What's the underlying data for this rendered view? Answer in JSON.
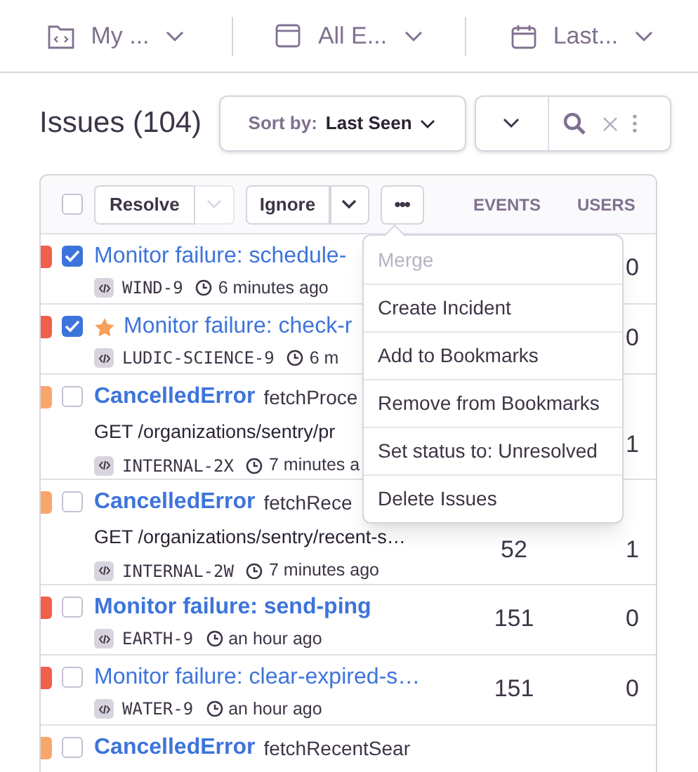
{
  "filters": [
    {
      "kind": "project",
      "label": "My ..."
    },
    {
      "kind": "environment",
      "label": "All E..."
    },
    {
      "kind": "date",
      "label": "Last..."
    }
  ],
  "header": {
    "title": "Issues (104)",
    "sort_label": "Sort by:",
    "sort_value": "Last Seen"
  },
  "toolbar": {
    "select_all_checked": false,
    "resolve": "Resolve",
    "resolve_menu_disabled": true,
    "ignore": "Ignore",
    "more": "•••",
    "columns": [
      "EVENTS",
      "USERS"
    ]
  },
  "issues": [
    {
      "color": "#f0604d",
      "checked": true,
      "starred": false,
      "unread": false,
      "title": "Monitor failure: schedule-",
      "short_id": "WIND-9",
      "time": "6 minutes ago",
      "users": "0"
    },
    {
      "color": "#f0604d",
      "checked": true,
      "starred": true,
      "unread": false,
      "title": "Monitor failure: check-r",
      "short_id": "LUDIC-SCIENCE-9",
      "time": "6 m",
      "users": "0"
    },
    {
      "color": "#f9a66d",
      "checked": false,
      "starred": false,
      "unread": true,
      "title": "CancelledError",
      "culprit": "fetchProce",
      "message": "GET /organizations/sentry/pr",
      "short_id": "INTERNAL-2X",
      "time": "7 minutes a",
      "users": "1"
    },
    {
      "color": "#f9a66d",
      "checked": false,
      "starred": false,
      "unread": true,
      "title": "CancelledError",
      "culprit": "fetchRece",
      "message": "GET /organizations/sentry/recent-s…",
      "short_id": "INTERNAL-2W",
      "time": "7 minutes ago",
      "events": "52",
      "users": "1"
    },
    {
      "color": "#f0604d",
      "checked": false,
      "starred": false,
      "unread": true,
      "title": "Monitor failure: send-ping",
      "short_id": "EARTH-9",
      "time": "an hour ago",
      "events": "151",
      "users": "0"
    },
    {
      "color": "#f0604d",
      "checked": false,
      "starred": false,
      "unread": false,
      "title": "Monitor failure: clear-expired-s…",
      "short_id": "WATER-9",
      "time": "an hour ago",
      "events": "151",
      "users": "0"
    },
    {
      "color": "#f9a66d",
      "checked": false,
      "starred": false,
      "unread": true,
      "title": "CancelledError",
      "culprit": "fetchRecentSear"
    }
  ],
  "menu": [
    {
      "label": "Merge",
      "disabled": true
    },
    {
      "label": "Create Incident",
      "disabled": false
    },
    {
      "label": "Add to Bookmarks",
      "disabled": false
    },
    {
      "label": "Remove from Bookmarks",
      "disabled": false
    },
    {
      "label": "Set status to: Unresolved",
      "disabled": false
    },
    {
      "label": "Delete Issues",
      "disabled": false
    }
  ]
}
